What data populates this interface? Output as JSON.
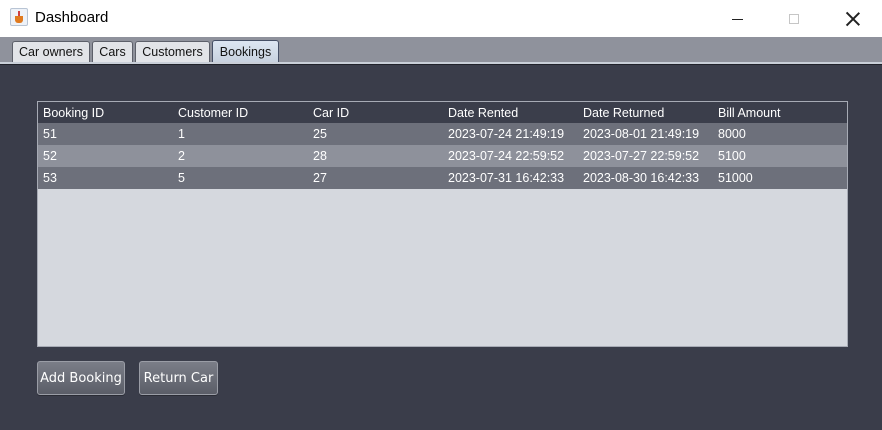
{
  "window": {
    "title": "Dashboard"
  },
  "tabs": [
    {
      "label": "Car owners",
      "selected": false
    },
    {
      "label": "Cars",
      "selected": false
    },
    {
      "label": "Customers",
      "selected": false
    },
    {
      "label": "Bookings",
      "selected": true
    }
  ],
  "table": {
    "columns": [
      "Booking ID",
      "Customer ID",
      "Car ID",
      "Date Rented",
      "Date Returned",
      "Bill Amount"
    ],
    "rows": [
      [
        "51",
        "1",
        "25",
        "2023-07-24 21:49:19",
        "2023-08-01 21:49:19",
        "8000"
      ],
      [
        "52",
        "2",
        "28",
        "2023-07-24 22:59:52",
        "2023-07-27 22:59:52",
        "5100"
      ],
      [
        "53",
        "5",
        "27",
        "2023-07-31 16:42:33",
        "2023-08-30 16:42:33",
        "51000"
      ]
    ]
  },
  "buttons": {
    "add_booking": "Add Booking",
    "return_car": "Return Car"
  },
  "colors": {
    "background": "#3a3d4a",
    "header": "#3b3e4b",
    "row_dark": "#6d707b",
    "row_light": "#8e919b"
  }
}
